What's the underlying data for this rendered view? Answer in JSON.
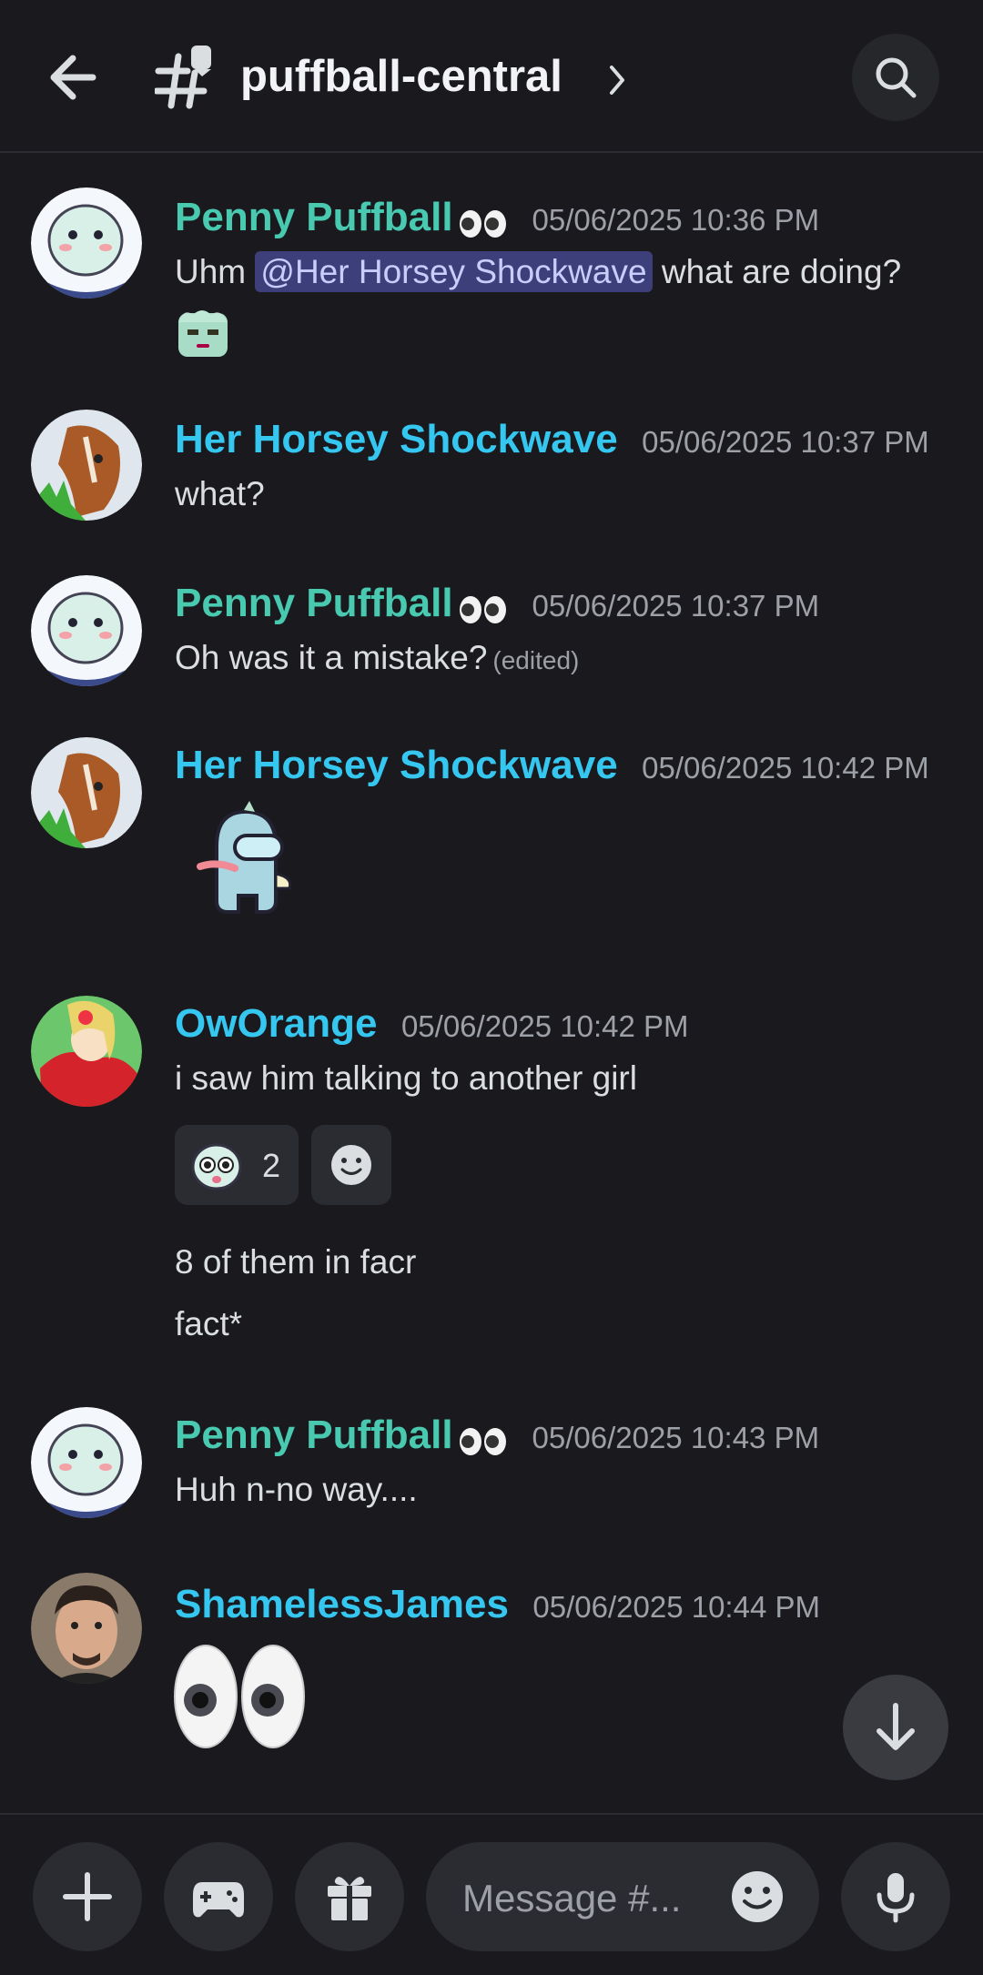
{
  "header": {
    "channel_name": "puffball-central",
    "icons": {
      "back": "arrow-left-icon",
      "channel": "hashtag-threads-icon",
      "chevron": "chevron-right-icon",
      "search": "search-icon"
    }
  },
  "messages": [
    {
      "author": "Penny Puffball",
      "timestamp": "05/06/2025 10:36 PM",
      "text_before": "Uhm ",
      "mention": "@Her Horsey Shockwave",
      "text_after": " what are doing?"
    },
    {
      "author": "Her Horsey Shockwave",
      "timestamp": "05/06/2025 10:37 PM",
      "text": "what?"
    },
    {
      "author": "Penny Puffball",
      "timestamp": "05/06/2025 10:37 PM",
      "text": "Oh  was it a mistake?",
      "edited": "(edited)"
    },
    {
      "author": "Her Horsey Shockwave",
      "timestamp": "05/06/2025 10:42 PM"
    },
    {
      "author": "OwOrange",
      "timestamp": "05/06/2025 10:42 PM",
      "text": "i saw him talking to another girl",
      "reaction_count": "2",
      "follow_1": "8 of them in facr",
      "follow_2": "fact*"
    },
    {
      "author": "Penny Puffball",
      "timestamp": "05/06/2025 10:43 PM",
      "text": "Huh n-no way...."
    },
    {
      "author": "ShamelessJames",
      "timestamp": "05/06/2025 10:44 PM"
    }
  ],
  "composer": {
    "placeholder": "Message #...",
    "icons": [
      "plus-icon",
      "gamepad-icon",
      "gift-icon",
      "emoji-icon",
      "microphone-icon"
    ]
  },
  "colors": {
    "background": "#1a1a1e",
    "teal_name": "#48c9b0",
    "blue_name": "#35c7f0",
    "mention_bg": "#3c3f7a"
  }
}
